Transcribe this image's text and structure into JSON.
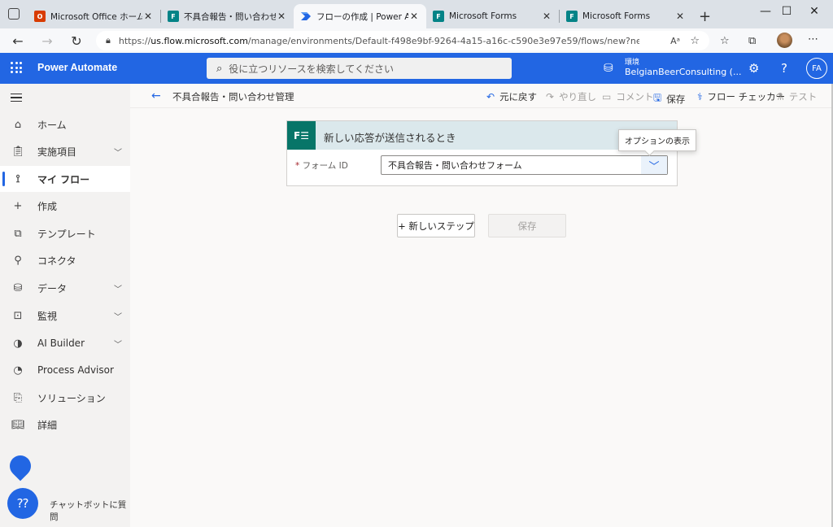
{
  "browser": {
    "tabs": [
      {
        "label": "Microsoft Office ホーム",
        "favicon": "office-icon"
      },
      {
        "label": "不具合報告・問い合わせフォ",
        "favicon": "forms-icon"
      },
      {
        "label": "フローの作成 | Power Autom",
        "favicon": "power-automate-icon",
        "active": true
      },
      {
        "label": "Microsoft Forms",
        "favicon": "forms-icon"
      },
      {
        "label": "Microsoft Forms",
        "favicon": "forms-icon"
      }
    ],
    "url_prefix": "https://",
    "url_domain": "us.flow.microsoft.com",
    "url_path": "/manage/environments/Default-f498e9bf-9264-4a15-a16c-c590e3e97e59/flows/new?newFlowName..."
  },
  "app": {
    "name": "Power Automate",
    "search_placeholder": "役に立つリソースを検索してください",
    "env_label": "環境",
    "env_value": "BelgianBeerConsulting (...",
    "avatar_initials": "FA",
    "accent_color": "#2266e3"
  },
  "nav": {
    "items": [
      {
        "label": "ホーム",
        "icon": "home-icon"
      },
      {
        "label": "実施項目",
        "icon": "clipboard-icon",
        "expandable": true
      },
      {
        "label": "マイ フロー",
        "icon": "flow-icon",
        "selected": true
      },
      {
        "label": "作成",
        "icon": "plus-icon"
      },
      {
        "label": "テンプレート",
        "icon": "template-icon"
      },
      {
        "label": "コネクタ",
        "icon": "connector-icon"
      },
      {
        "label": "データ",
        "icon": "database-icon",
        "expandable": true
      },
      {
        "label": "監視",
        "icon": "monitor-icon",
        "expandable": true
      },
      {
        "label": "AI Builder",
        "icon": "ai-builder-icon",
        "expandable": true
      },
      {
        "label": "Process Advisor",
        "icon": "process-advisor-icon"
      },
      {
        "label": "ソリューション",
        "icon": "solutions-icon"
      },
      {
        "label": "詳細",
        "icon": "book-icon"
      }
    ],
    "chatbot_label": "チャットボットに質問"
  },
  "command_bar": {
    "flow_name": "不具合報告・問い合わせ管理",
    "undo": "元に戻す",
    "redo": "やり直し",
    "comment": "コメント",
    "save": "保存",
    "flow_checker": "フロー チェッカー",
    "test": "テスト"
  },
  "trigger_card": {
    "title": "新しい応答が送信されるとき",
    "field_label": "フォーム ID",
    "field_required_mark": "*",
    "field_value": "不具合報告・問い合わせフォーム",
    "tooltip": "オプションの表示"
  },
  "actions": {
    "new_step": "+ 新しいステップ",
    "save": "保存"
  }
}
